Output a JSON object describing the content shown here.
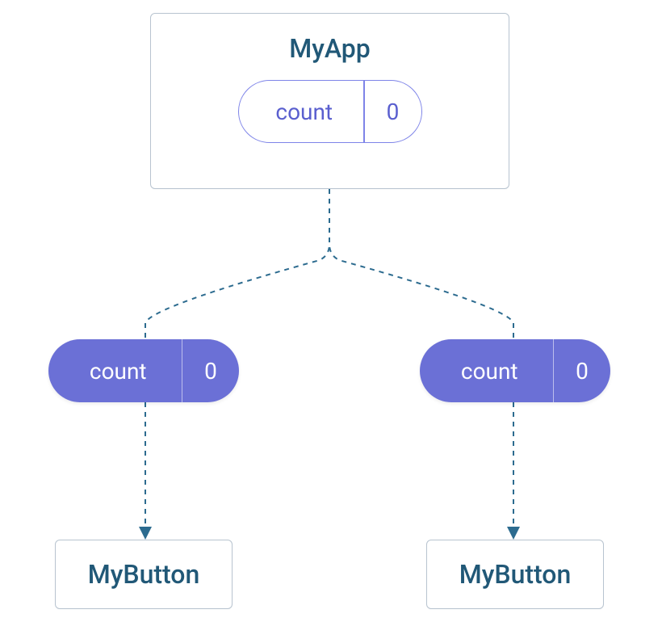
{
  "parent": {
    "title": "MyApp",
    "state": {
      "label": "count",
      "value": "0"
    }
  },
  "props": {
    "left": {
      "label": "count",
      "value": "0"
    },
    "right": {
      "label": "count",
      "value": "0"
    }
  },
  "children": {
    "left": {
      "title": "MyButton"
    },
    "right": {
      "title": "MyButton"
    }
  }
}
